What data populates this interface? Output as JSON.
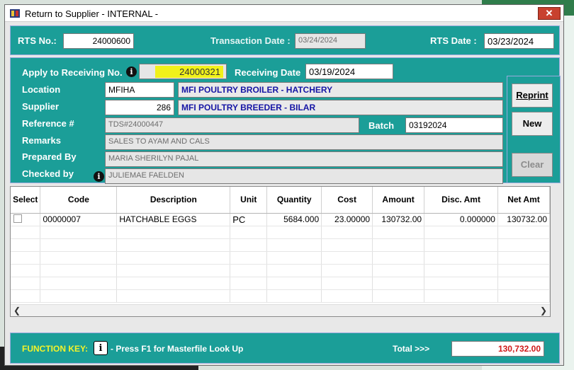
{
  "window": {
    "title": "Return to Supplier - INTERNAL -",
    "close_label": "✕"
  },
  "header": {
    "rts_no_label": "RTS No.:",
    "rts_no_value": "24000600",
    "transaction_date_label": "Transaction Date :",
    "transaction_date_value": "03/24/2024",
    "rts_date_label": "RTS Date :",
    "rts_date_value": "03/23/2024"
  },
  "form": {
    "apply_label": "Apply to Receiving No.",
    "apply_value": "24000321",
    "receiving_date_label": "Receiving Date",
    "receiving_date_value": "03/19/2024",
    "location_label": "Location",
    "location_code": "MFIHA",
    "location_name": "MFI POULTRY BROILER - HATCHERY",
    "supplier_label": "Supplier",
    "supplier_code": "286",
    "supplier_name": "MFI POULTRY BREEDER - BILAR",
    "reference_label": "Reference #",
    "reference_value": "TDS#24000447",
    "batch_label": "Batch",
    "batch_value": "03192024",
    "remarks_label": "Remarks",
    "remarks_value": "SALES TO AYAM AND CALS",
    "prepared_label": "Prepared By",
    "prepared_value": "MARIA SHERILYN PAJAL",
    "checked_label": "Checked by",
    "checked_value": "JULIEMAE FAELDEN"
  },
  "buttons": {
    "reprint": "Reprint",
    "new": "New",
    "clear": "Clear"
  },
  "grid": {
    "headers": [
      "Select",
      "Code",
      "Description",
      "Unit",
      "Quantity",
      "Cost",
      "Amount",
      "Disc. Amt",
      "Net Amt"
    ],
    "rows": [
      {
        "code": "00000007",
        "description": "HATCHABLE EGGS",
        "unit": "PC",
        "quantity": "5684.000",
        "cost": "23.00000",
        "amount": "130732.00",
        "disc": "0.000000",
        "net": "130732.00"
      }
    ]
  },
  "footer": {
    "function_key_label": "FUNCTION KEY:",
    "hint": "- Press F1 for Masterfile Look Up",
    "total_label": "Total >>>",
    "total_value": "130,732.00"
  },
  "colors": {
    "panel": "#1b9e98",
    "highlight": "#f1f11a",
    "total_red": "#d01818"
  }
}
